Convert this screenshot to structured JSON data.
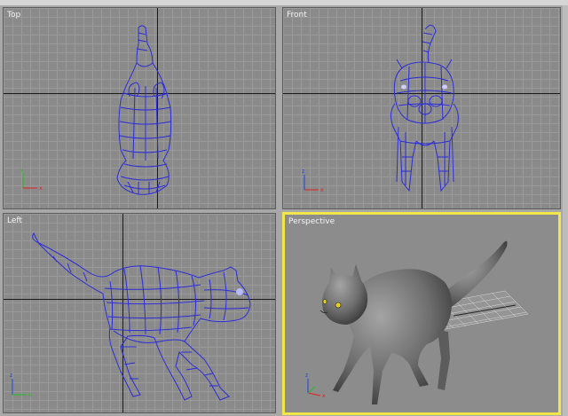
{
  "viewports": {
    "top": {
      "label": "Top"
    },
    "front": {
      "label": "Front"
    },
    "left": {
      "label": "Left"
    },
    "perspective": {
      "label": "Perspective"
    }
  },
  "colors": {
    "wire": "#2c2cd8",
    "grid_bg": "#8a8a8a",
    "active_border": "#f2e64a",
    "axis_x": "#e02020",
    "axis_y": "#20c020",
    "axis_z": "#2040e0",
    "shaded_cat": "#6e6e6e"
  },
  "icons": {
    "axis_gizmo": "axis-gizmo-icon"
  }
}
